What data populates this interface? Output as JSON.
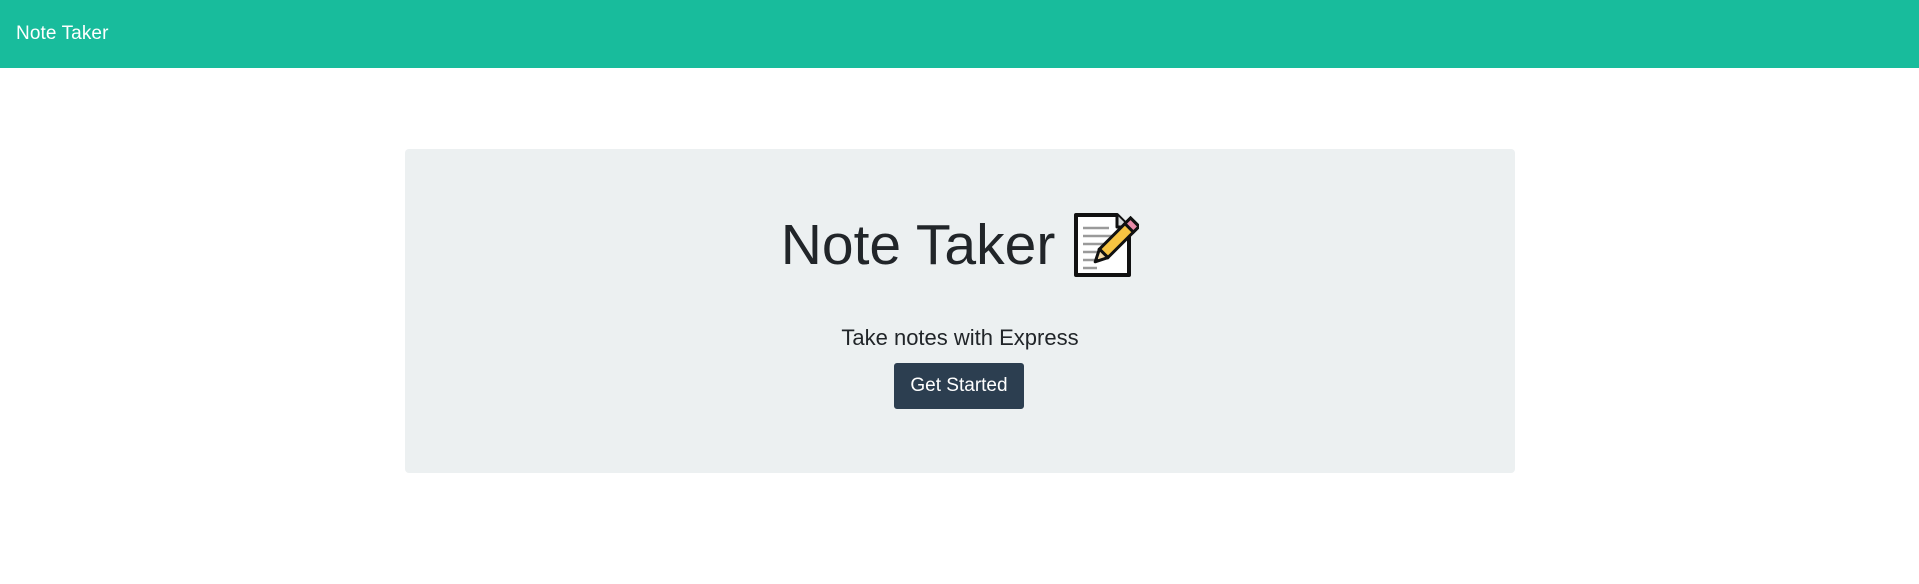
{
  "navbar": {
    "brand": "Note Taker",
    "background_color": "#18bc9c"
  },
  "hero": {
    "title": "Note Taker",
    "title_icon": "memo-icon",
    "subtitle": "Take notes with Express",
    "cta_label": "Get Started",
    "background_color": "#ecf0f1",
    "cta_color": "#2c3e50"
  }
}
